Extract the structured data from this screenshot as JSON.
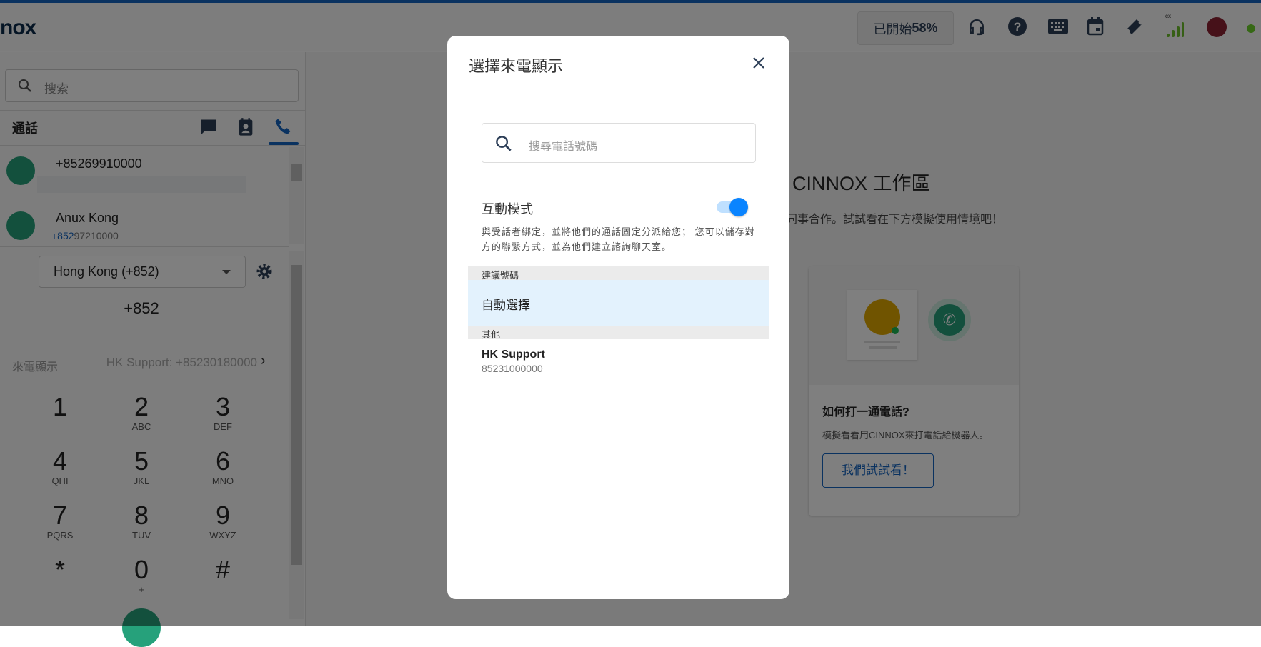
{
  "header": {
    "logo_text": "nox",
    "progress_prefix": "已開始",
    "progress_value": "58%",
    "signal_label": "cx",
    "icons": [
      "headset-icon",
      "help-icon",
      "keyboard-icon",
      "calendar-icon",
      "ticket-icon",
      "signal-icon",
      "avatar",
      "status-dot"
    ]
  },
  "sidebar": {
    "search_placeholder": "搜索",
    "section_title": "通話",
    "calls": [
      {
        "name": "+85269910000",
        "sub": ""
      },
      {
        "name": "Anux Kong",
        "sub_prefix": "+852",
        "sub_rest": "97210000"
      }
    ],
    "country": "Hong Kong (+852)",
    "dial_value": "+852",
    "caller_id_label": "來電顯示",
    "caller_id_value": "HK Support: +85230180000",
    "keys": [
      {
        "d": "1",
        "l": ""
      },
      {
        "d": "2",
        "l": "ABC"
      },
      {
        "d": "3",
        "l": "DEF"
      },
      {
        "d": "4",
        "l": "QHI"
      },
      {
        "d": "5",
        "l": "JKL"
      },
      {
        "d": "6",
        "l": "MNO"
      },
      {
        "d": "7",
        "l": "PQRS"
      },
      {
        "d": "8",
        "l": "TUV"
      },
      {
        "d": "9",
        "l": "WXYZ"
      },
      {
        "d": "*",
        "l": ""
      },
      {
        "d": "0",
        "l": "+"
      },
      {
        "d": "#",
        "l": ""
      }
    ]
  },
  "main": {
    "title": "CINNOX 工作區",
    "subtitle": "同事合作。試試看在下方模擬使用情境吧！",
    "card_title": "如何打一通電話?",
    "card_desc": "模擬看看用CINNOX來打電話給機器人。",
    "card_button": "我們試試看！"
  },
  "modal": {
    "title": "選擇來電顯示",
    "search_placeholder": "搜尋電話號碼",
    "mode_label": "互動模式",
    "mode_on": true,
    "mode_desc": "與受話者綁定，並將他們的通話固定分派給您； 您可以儲存對方的聯繫方式，並為他們建立諮詢聊天室。",
    "suggested_header": "建議號碼",
    "auto_select": "自動選擇",
    "other_header": "其他",
    "options": [
      {
        "name": "HK Support",
        "number": "85231000000"
      }
    ]
  },
  "colors": {
    "accent": "#1565c0",
    "toggle": "#0a84ff",
    "green": "#26a17b"
  }
}
